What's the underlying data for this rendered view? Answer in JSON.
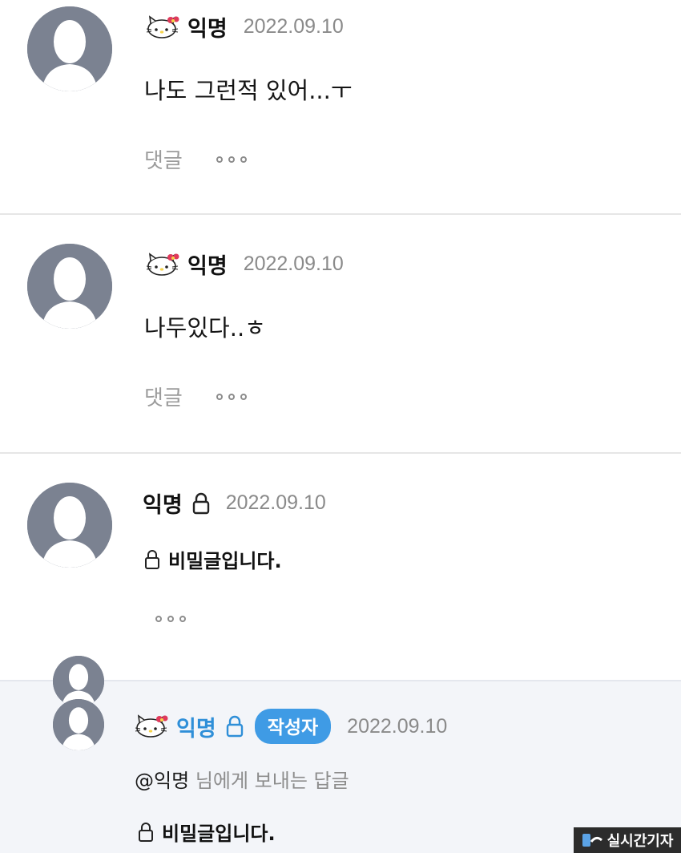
{
  "comments": [
    {
      "author": "익명",
      "date": "2022.09.10",
      "text": "나도 그런적 있어...ㅜ",
      "reply_label": "댓글",
      "has_kitty": true
    },
    {
      "author": "익명",
      "date": "2022.09.10",
      "text": "나두있다..ㅎ",
      "reply_label": "댓글",
      "has_kitty": true
    },
    {
      "author": "익명",
      "date": "2022.09.10",
      "secret_text": "비밀글입니다.",
      "locked": true
    }
  ],
  "reply": {
    "author": "익명",
    "badge": "작성자",
    "date": "2022.09.10",
    "mention_at": "@익명",
    "mention_rest": "님에게 보내는 답글",
    "secret_text": "비밀글입니다.",
    "locked": true
  },
  "watermark": "실시간기자",
  "icons": {
    "avatar": "default-user-avatar",
    "kitty": "hello-kitty-icon",
    "lock": "lock-icon",
    "more": "more-options-icon"
  },
  "colors": {
    "avatar_bg": "#7b8291",
    "author_blue": "#2f8fd8",
    "badge_bg": "#3f9be5",
    "reply_bg": "#f3f5f9"
  }
}
